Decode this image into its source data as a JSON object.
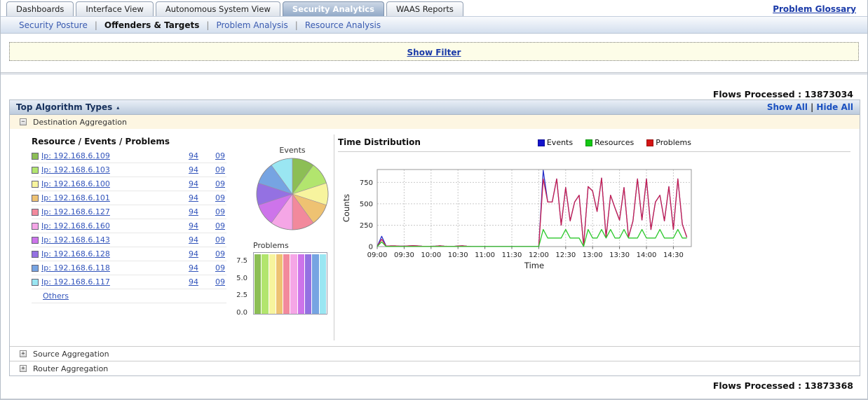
{
  "tabs": {
    "items": [
      {
        "label": "Dashboards",
        "active": false
      },
      {
        "label": "Interface View",
        "active": false
      },
      {
        "label": "Autonomous System View",
        "active": false
      },
      {
        "label": "Security Analytics",
        "active": true
      },
      {
        "label": "WAAS Reports",
        "active": false
      }
    ]
  },
  "header": {
    "problem_glossary": "Problem Glossary"
  },
  "subnav": {
    "items": [
      {
        "label": "Security Posture",
        "active": false
      },
      {
        "label": "Offenders & Targets",
        "active": true
      },
      {
        "label": "Problem Analysis",
        "active": false
      },
      {
        "label": "Resource Analysis",
        "active": false
      }
    ],
    "separator": "|"
  },
  "filter": {
    "show_filter_label": "Show Filter"
  },
  "flows": {
    "top": "Flows Processed : 13873034",
    "bottom": "Flows Processed : 13873368"
  },
  "section": {
    "title": "Top Algorithm Types",
    "indicator": "▴",
    "show_all": "Show All",
    "separator": "|",
    "hide_all": "Hide All"
  },
  "icons": {
    "collapse": "−",
    "expand": "+"
  },
  "aggregations": {
    "destination": "Destination Aggregation",
    "source": "Source Aggregation",
    "router": "Router Aggregation"
  },
  "resource_panel": {
    "title": "Resource / Events / Problems",
    "others": "Others",
    "rows": [
      {
        "ip": "Ip: 192.168.6.109",
        "events": "94",
        "problems": "09",
        "color": "#8cbe55"
      },
      {
        "ip": "Ip: 192.168.6.103",
        "events": "94",
        "problems": "09",
        "color": "#b2e56e"
      },
      {
        "ip": "Ip: 192.168.6.100",
        "events": "94",
        "problems": "09",
        "color": "#f7f49e"
      },
      {
        "ip": "Ip: 192.168.6.101",
        "events": "94",
        "problems": "09",
        "color": "#eec272"
      },
      {
        "ip": "Ip: 192.168.6.127",
        "events": "94",
        "problems": "09",
        "color": "#f2899c"
      },
      {
        "ip": "Ip: 192.168.6.160",
        "events": "94",
        "problems": "09",
        "color": "#f5a6e6"
      },
      {
        "ip": "Ip: 192.168.6.143",
        "events": "94",
        "problems": "09",
        "color": "#cd74ea"
      },
      {
        "ip": "Ip: 192.168.6.128",
        "events": "94",
        "problems": "09",
        "color": "#9471e2"
      },
      {
        "ip": "Ip: 192.168.6.118",
        "events": "94",
        "problems": "09",
        "color": "#76a4e2"
      },
      {
        "ip": "Ip: 192.168.6.117",
        "events": "94",
        "problems": "09",
        "color": "#9ae6f2"
      }
    ]
  },
  "time_panel": {
    "title": "Time Distribution",
    "legend": [
      {
        "label": "Events",
        "color": "#1414cc"
      },
      {
        "label": "Resources",
        "color": "#14c814"
      },
      {
        "label": "Problems",
        "color": "#d41414"
      }
    ]
  },
  "chart_data": [
    {
      "type": "pie",
      "title": "Events",
      "labels": [
        "Ip: 192.168.6.109",
        "Ip: 192.168.6.103",
        "Ip: 192.168.6.100",
        "Ip: 192.168.6.101",
        "Ip: 192.168.6.127",
        "Ip: 192.168.6.160",
        "Ip: 192.168.6.143",
        "Ip: 192.168.6.128",
        "Ip: 192.168.6.118",
        "Ip: 192.168.6.117"
      ],
      "values": [
        10,
        10,
        10,
        10,
        10,
        10,
        10,
        10,
        10,
        10
      ],
      "colors": [
        "#8cbe55",
        "#b2e56e",
        "#f7f49e",
        "#eec272",
        "#f2899c",
        "#f5a6e6",
        "#cd74ea",
        "#9471e2",
        "#76a4e2",
        "#9ae6f2"
      ],
      "start_angle": -90,
      "direction": "clockwise"
    },
    {
      "type": "bar",
      "title": "Problems",
      "categories": [
        "Ip: 192.168.6.109",
        "Ip: 192.168.6.103",
        "Ip: 192.168.6.100",
        "Ip: 192.168.6.101",
        "Ip: 192.168.6.127",
        "Ip: 192.168.6.160",
        "Ip: 192.168.6.143",
        "Ip: 192.168.6.128",
        "Ip: 192.168.6.118",
        "Ip: 192.168.6.117"
      ],
      "values": [
        8.8,
        8.8,
        8.8,
        8.8,
        8.8,
        8.8,
        8.8,
        8.8,
        8.8,
        8.8
      ],
      "colors": [
        "#8cbe55",
        "#b2e56e",
        "#f7f49e",
        "#eec272",
        "#f2899c",
        "#f5a6e6",
        "#cd74ea",
        "#9471e2",
        "#76a4e2",
        "#9ae6f2"
      ],
      "yticks": [
        7.5,
        5,
        2.5,
        0
      ],
      "ylim": [
        0,
        9
      ]
    },
    {
      "type": "line",
      "title": "Time Distribution",
      "xlabel": "Time",
      "ylabel": "Counts",
      "ylim": [
        0,
        900
      ],
      "yticks": [
        0,
        250,
        500,
        750
      ],
      "x_domain": [
        0,
        350
      ],
      "xtick_labels": [
        "09:00",
        "09:30",
        "10:00",
        "10:30",
        "11:00",
        "11:30",
        "12:00",
        "12:30",
        "13:00",
        "13:30",
        "14:00",
        "14:30"
      ],
      "xtick_minutes": [
        0,
        30,
        60,
        90,
        120,
        150,
        180,
        210,
        240,
        270,
        300,
        330
      ],
      "x_minutes": [
        0,
        5,
        10,
        15,
        20,
        25,
        30,
        35,
        40,
        45,
        50,
        55,
        60,
        65,
        70,
        75,
        80,
        85,
        90,
        95,
        100,
        105,
        110,
        115,
        120,
        125,
        130,
        135,
        140,
        145,
        150,
        155,
        160,
        165,
        170,
        175,
        180,
        185,
        190,
        195,
        200,
        205,
        210,
        215,
        220,
        225,
        230,
        235,
        240,
        245,
        250,
        255,
        260,
        265,
        270,
        275,
        280,
        285,
        290,
        295,
        300,
        305,
        310,
        315,
        320,
        325,
        330,
        335,
        340,
        345
      ],
      "grid": true,
      "legend_position": "top-right",
      "series": [
        {
          "name": "Events",
          "color": "#2830c8",
          "values": [
            2,
            120,
            5,
            8,
            8,
            5,
            5,
            8,
            10,
            8,
            4,
            2,
            3,
            5,
            9,
            4,
            2,
            2,
            7,
            9,
            4,
            1,
            1,
            1,
            1,
            1,
            1,
            1,
            1,
            1,
            1,
            1,
            1,
            1,
            1,
            1,
            2,
            890,
            520,
            520,
            790,
            250,
            690,
            300,
            520,
            600,
            10,
            700,
            650,
            410,
            800,
            110,
            600,
            450,
            310,
            690,
            110,
            300,
            790,
            310,
            790,
            200,
            520,
            600,
            300,
            700,
            200,
            790,
            260,
            110
          ]
        },
        {
          "name": "Problems",
          "color": "#c82050",
          "values": [
            2,
            85,
            5,
            8,
            8,
            5,
            5,
            8,
            10,
            8,
            4,
            2,
            3,
            5,
            9,
            4,
            2,
            2,
            7,
            9,
            4,
            1,
            1,
            1,
            1,
            1,
            1,
            1,
            1,
            1,
            1,
            1,
            1,
            1,
            1,
            1,
            2,
            790,
            520,
            520,
            790,
            250,
            690,
            300,
            520,
            600,
            10,
            700,
            650,
            410,
            800,
            110,
            600,
            450,
            310,
            690,
            110,
            300,
            790,
            310,
            790,
            200,
            520,
            600,
            300,
            700,
            200,
            790,
            260,
            110
          ]
        },
        {
          "name": "Resources",
          "color": "#2cc82c",
          "values": [
            1,
            55,
            1,
            1,
            1,
            1,
            1,
            1,
            1,
            1,
            1,
            1,
            1,
            1,
            1,
            1,
            1,
            1,
            1,
            1,
            1,
            1,
            1,
            1,
            1,
            1,
            1,
            1,
            1,
            1,
            1,
            1,
            1,
            1,
            1,
            1,
            2,
            200,
            100,
            100,
            100,
            100,
            200,
            100,
            100,
            100,
            2,
            200,
            100,
            100,
            200,
            100,
            200,
            100,
            100,
            200,
            100,
            100,
            100,
            200,
            100,
            100,
            100,
            200,
            100,
            100,
            100,
            200,
            100,
            100
          ]
        }
      ]
    }
  ]
}
